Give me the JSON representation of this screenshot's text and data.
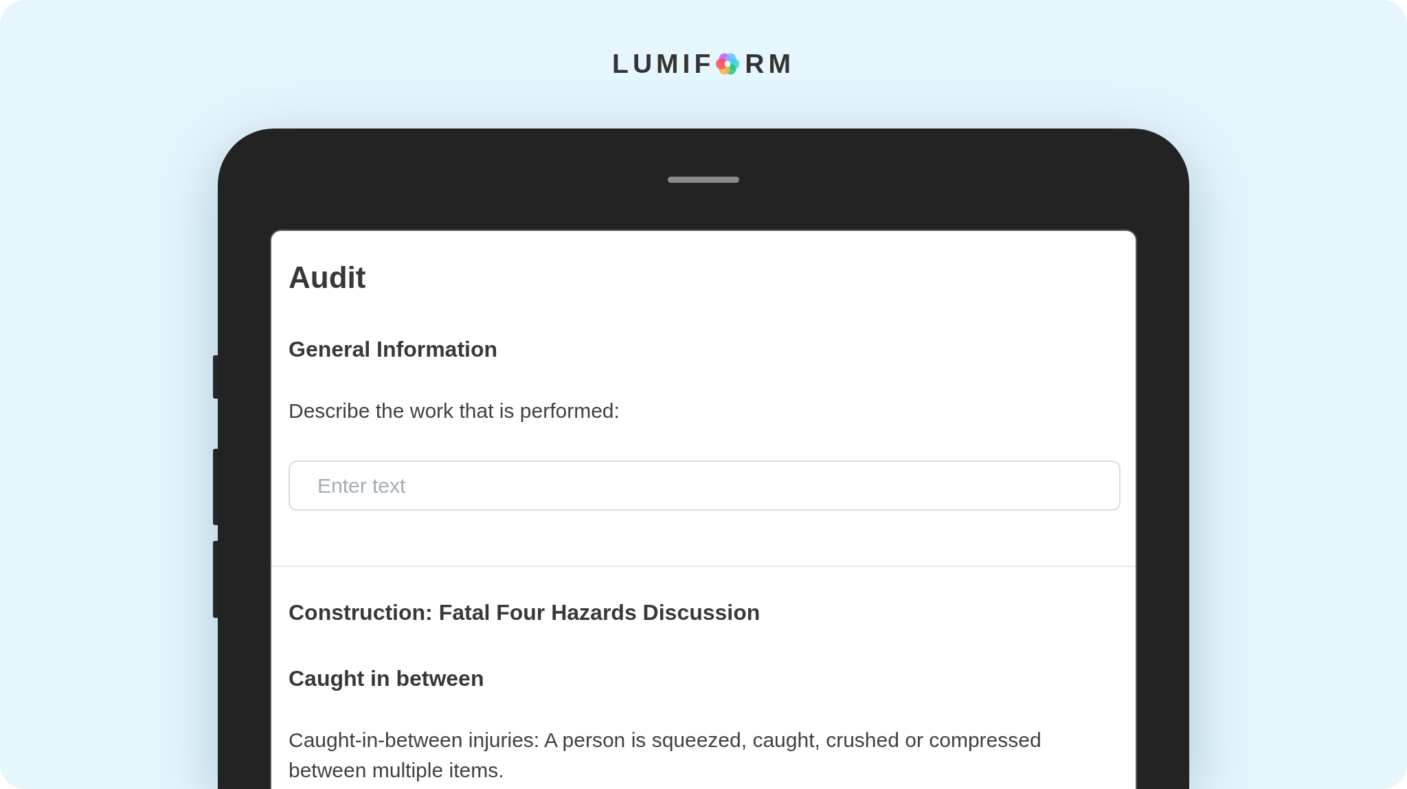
{
  "logo": {
    "text_start": "LUMIF",
    "text_end": "RM"
  },
  "form": {
    "title": "Audit",
    "sections": [
      {
        "heading": "General Information",
        "blocks": [
          {
            "kind": "label",
            "text": "Describe the work that is performed:"
          },
          {
            "kind": "text_field",
            "placeholder": "Enter text"
          }
        ]
      },
      {
        "heading": "Construction: Fatal Four Hazards Discussion",
        "blocks": [
          {
            "kind": "subheading",
            "text": "Caught in between"
          },
          {
            "kind": "paragraph",
            "text": "Caught-in-between injuries: A person is squeezed, caught, crushed or compressed between multiple items."
          }
        ]
      }
    ]
  }
}
